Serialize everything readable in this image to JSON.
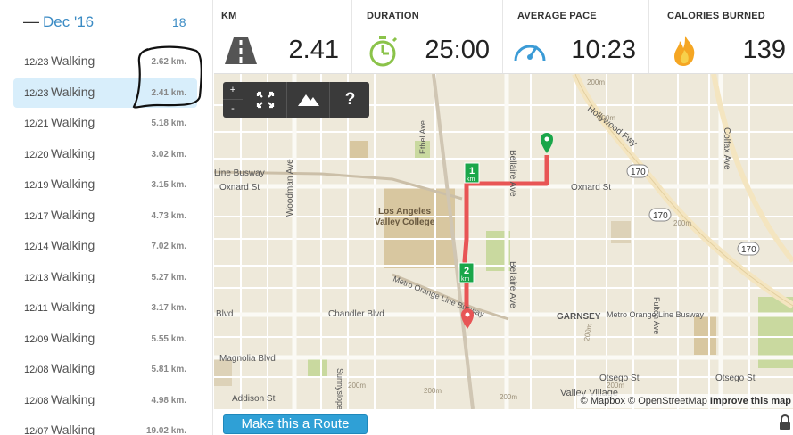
{
  "sidebar": {
    "month": {
      "collapse_icon": "dash-icon",
      "label": "Dec '16",
      "count": "18"
    },
    "activities": [
      {
        "date": "12/23",
        "type": "Walking",
        "distance": "2.62 km."
      },
      {
        "date": "12/23",
        "type": "Walking",
        "distance": "2.41 km.",
        "selected": true
      },
      {
        "date": "12/21",
        "type": "Walking",
        "distance": "5.18 km."
      },
      {
        "date": "12/20",
        "type": "Walking",
        "distance": "3.02 km."
      },
      {
        "date": "12/19",
        "type": "Walking",
        "distance": "3.15 km."
      },
      {
        "date": "12/17",
        "type": "Walking",
        "distance": "4.73 km."
      },
      {
        "date": "12/14",
        "type": "Walking",
        "distance": "7.02 km."
      },
      {
        "date": "12/13",
        "type": "Walking",
        "distance": "5.27 km."
      },
      {
        "date": "12/11",
        "type": "Walking",
        "distance": "3.17 km."
      },
      {
        "date": "12/09",
        "type": "Walking",
        "distance": "5.55 km."
      },
      {
        "date": "12/08",
        "type": "Walking",
        "distance": "5.81 km."
      },
      {
        "date": "12/08",
        "type": "Walking",
        "distance": "4.98 km."
      },
      {
        "date": "12/07",
        "type": "Walking",
        "distance": "19.02 km."
      }
    ]
  },
  "stats": [
    {
      "label": "KM",
      "value": "2.41",
      "icon": "road-icon"
    },
    {
      "label": "DURATION",
      "value": "25:00",
      "icon": "stopwatch-icon"
    },
    {
      "label": "AVERAGE PACE",
      "value": "10:23",
      "icon": "speedometer-icon"
    },
    {
      "label": "CALORIES BURNED",
      "value": "139",
      "icon": "flame-icon"
    }
  ],
  "map": {
    "controls": {
      "zoom_in": "+",
      "zoom_out": "-",
      "help": "?"
    },
    "labels": {
      "oxnard_left": "Oxnard St",
      "oxnard_right": "Oxnard St",
      "busway_top": "Line Busway",
      "college": "Los Angeles Valley College",
      "woodman": "Woodman Ave",
      "ethel": "Ethel Ave",
      "bellaire_top": "Bellaire Ave",
      "bellaire_bottom": "Bellaire Ave",
      "fulton": "Fulton Ave",
      "colfax": "Colfax Ave",
      "hollywood": "Hollywood Fwy",
      "chandler": "Chandler Blvd",
      "blvd": "Blvd",
      "garnsey": "GARNSEY",
      "busway_mid": "Metro Orange Line Busway",
      "busway_left": "Metro Orange Line Busway",
      "sunnyslope": "Sunnyslope Ave",
      "magnolia": "Magnolia Blvd",
      "otsego_1": "Otsego St",
      "otsego_2": "Otsego St",
      "addison": "Addison St",
      "valley_village": "Valley Village",
      "hwy_170_1": "170",
      "hwy_170_2": "170",
      "hwy_170_3": "170",
      "marker_1": "1",
      "marker_2": "2",
      "marker_unit": "km",
      "elev_200_1": "200m",
      "elev_200_2": "200m",
      "elev_200_3": "200m",
      "elev_200_4": "200m",
      "elev_200_5": "200m",
      "elev_200_6": "200m",
      "elev_200_7": "200m",
      "elev_200_8": "200m"
    },
    "attribution": {
      "mapbox": "© Mapbox",
      "osm": "© OpenStreetMap",
      "improve": "Improve this map"
    },
    "colors": {
      "route": "#e85555",
      "start_pin": "#1aa64a",
      "end_pin": "#e85555",
      "park": "#c9d99f",
      "campus": "#d8c7a0"
    }
  },
  "bottom": {
    "route_button": "Make this a Route",
    "lock_icon": "lock-icon"
  }
}
